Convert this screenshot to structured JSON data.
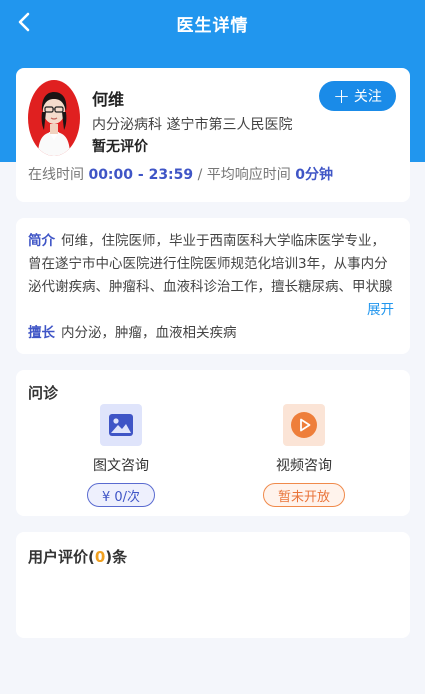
{
  "nav": {
    "title": "医生详情",
    "back_icon": "chevron-left-icon"
  },
  "doctor": {
    "name": "何维",
    "department": "内分泌病科",
    "hospital": "遂宁市第三人民医院",
    "rating": "暂无评价",
    "follow_label": "关注",
    "online_label": "在线时间",
    "online_hours": "00:00 - 23:59",
    "separator": "/",
    "response_label": "平均响应时间",
    "response_time": "0分钟"
  },
  "intro": {
    "label": "简介",
    "text": "何维，住院医师，毕业于西南医科大学临床医学专业，曾在遂宁市中心医院进行住院医师规范化培训3年，从事内分泌代谢疾病、肿瘤科、血液科诊治工作，擅长糖尿病、甲状腺疾病、骨质疏松等内分泌科疾病",
    "expand_label": "展开",
    "skill_label": "擅长",
    "skill_text": "内分泌，肿瘤，血液相关疾病"
  },
  "consult": {
    "title": "问诊",
    "services": [
      {
        "label": "图文咨询",
        "price": "¥ 0/次",
        "icon": "image-icon",
        "color": "#3f55c6"
      },
      {
        "label": "视频咨询",
        "price": "暂未开放",
        "icon": "video-play-icon",
        "color": "#e9743a"
      }
    ]
  },
  "reviews": {
    "prefix": "用户评价(",
    "count": "0",
    "suffix": ")条"
  },
  "colors": {
    "primary": "#2196ee",
    "accent": "#3f55c6",
    "orange": "#e9743a",
    "count": "#f0a020"
  }
}
